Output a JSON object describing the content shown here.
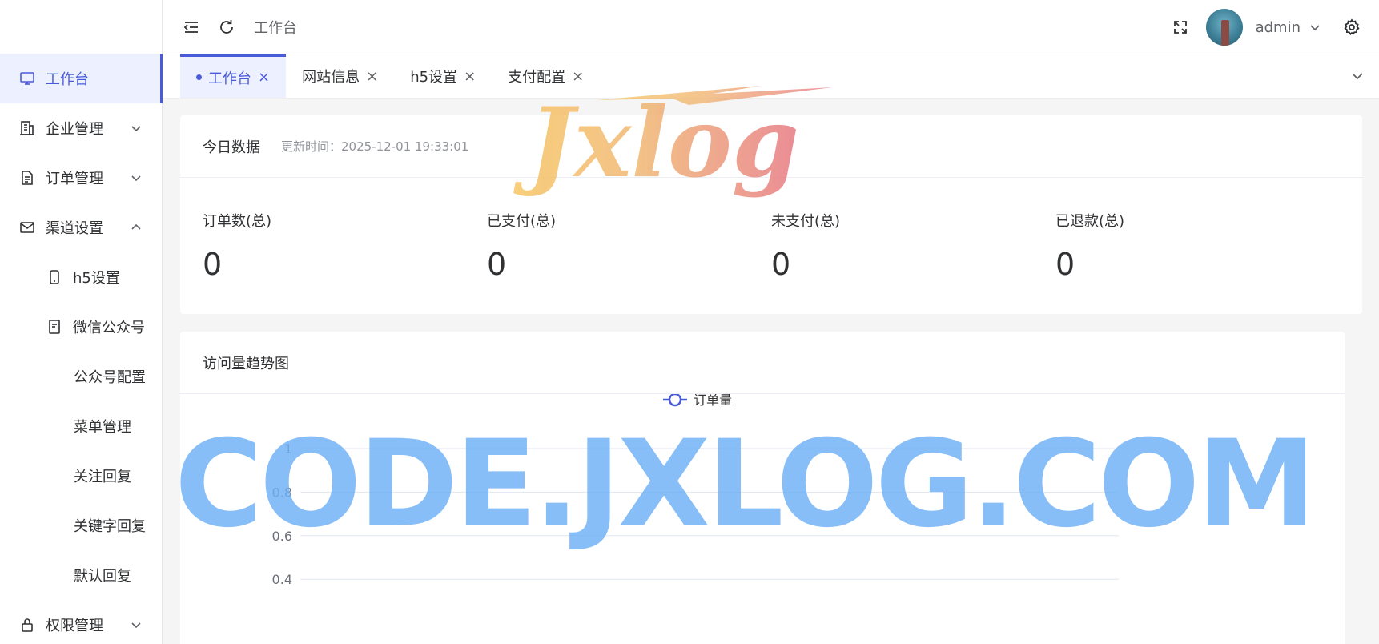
{
  "sidebar": {
    "items": [
      {
        "label": "工作台",
        "icon": "monitor-icon",
        "level": 1,
        "active": true
      },
      {
        "label": "企业管理",
        "icon": "building-icon",
        "level": 1,
        "arrow": "down"
      },
      {
        "label": "订单管理",
        "icon": "document-icon",
        "level": 1,
        "arrow": "down"
      },
      {
        "label": "渠道设置",
        "icon": "mail-icon",
        "level": 1,
        "arrow": "up"
      },
      {
        "label": "h5设置",
        "icon": "mobile-icon",
        "level": 2
      },
      {
        "label": "微信公众号",
        "icon": "notebook-icon",
        "level": 2
      },
      {
        "label": "公众号配置",
        "level": 3
      },
      {
        "label": "菜单管理",
        "level": 3
      },
      {
        "label": "关注回复",
        "level": 3
      },
      {
        "label": "关键字回复",
        "level": 3
      },
      {
        "label": "默认回复",
        "level": 3
      },
      {
        "label": "权限管理",
        "icon": "lock-icon",
        "level": 1,
        "arrow": "down"
      }
    ]
  },
  "header": {
    "breadcrumb": "工作台",
    "user_name": "admin"
  },
  "tabs": [
    {
      "label": "工作台",
      "active": true
    },
    {
      "label": "网站信息"
    },
    {
      "label": "h5设置"
    },
    {
      "label": "支付配置"
    }
  ],
  "today": {
    "title": "今日数据",
    "updated": "更新时间：2025-12-01 19:33:01",
    "stats": [
      {
        "label": "订单数(总)",
        "value": "0"
      },
      {
        "label": "已支付(总)",
        "value": "0"
      },
      {
        "label": "未支付(总)",
        "value": "0"
      },
      {
        "label": "已退款(总)",
        "value": "0"
      }
    ]
  },
  "trend": {
    "title": "访问量趋势图"
  },
  "chart_data": {
    "type": "line",
    "series": [
      {
        "name": "订单量",
        "values": []
      }
    ],
    "yticks": [
      "1",
      "0.8",
      "0.6",
      "0.4"
    ],
    "ylim": [
      0,
      1
    ],
    "grid": true,
    "legend": "top-center"
  },
  "watermarks": {
    "logo_text": "Jxlog",
    "banner_text": "CODE.JXLOG.COM"
  },
  "colors": {
    "accent": "#4a5bd9",
    "active_bg": "#ecf0ff"
  }
}
